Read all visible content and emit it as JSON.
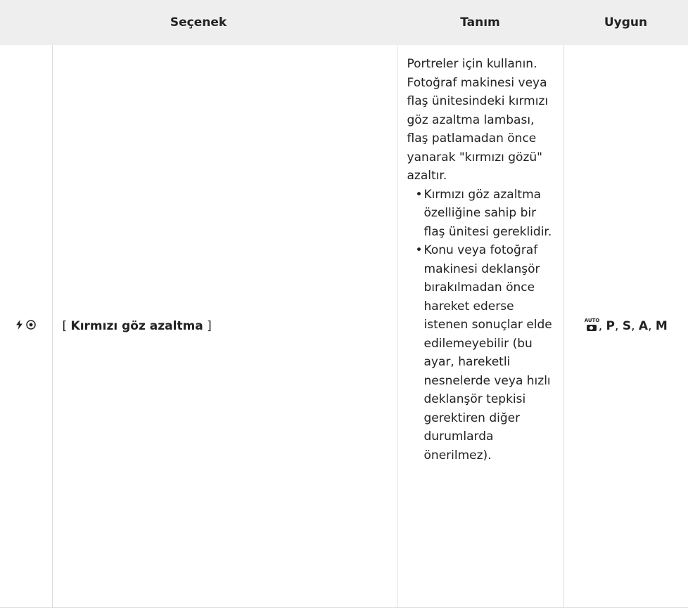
{
  "header": {
    "option": "Seçenek",
    "description": "Tanım",
    "available": "Uygun"
  },
  "row": {
    "icon": "flash-red-eye-icon",
    "name_open": "[ ",
    "name": "Kırmızı göz azaltma",
    "name_close": " ]",
    "desc_intro": "Portreler için kullanın. Fotoğraf makinesi veya flaş ünitesindeki kırmızı göz azaltma lambası, flaş patlamadan önce yanarak \"kırmızı gözü\" azaltır.",
    "bullets": [
      "Kırmızı göz azaltma özelliğine sahip bir flaş ünitesi gereklidir.",
      "Konu veya fotoğraf makinesi deklanşör bırakılmadan önce hareket ederse istenen sonuçlar elde edilemeyebilir (bu ayar, hareketli nesnelerde veya hızlı deklanşör tepkisi gerektiren diğer durumlarda önerilmez)."
    ],
    "modes": {
      "auto_icon": "auto-mode-icon",
      "auto_text": "AUTO",
      "sep": ",",
      "p": "P",
      "s": "S",
      "a": "A",
      "m": "M"
    }
  }
}
